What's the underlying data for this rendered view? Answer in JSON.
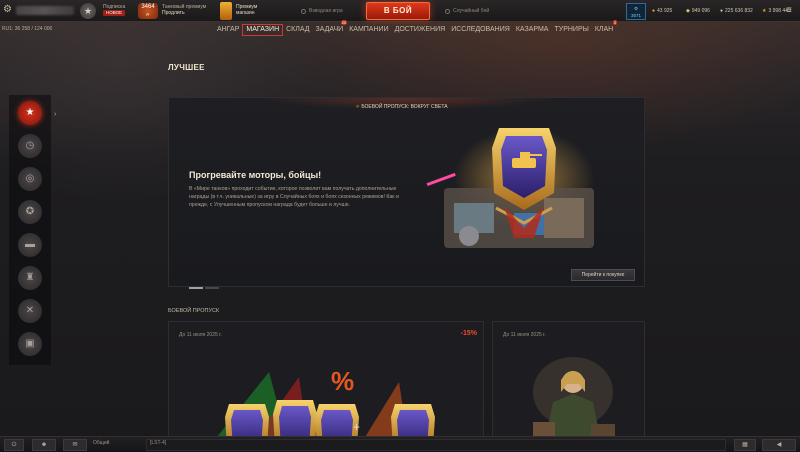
{
  "topbar": {
    "subscription_label": "Подписка",
    "subscription_badge": "НОВОЕ",
    "premium_days": "3464",
    "premium_days_unit": "д.",
    "tank_premium_label": "Танковый премиум",
    "tank_premium_action": "Продлить",
    "premium_shop_line1": "Премиум",
    "premium_shop_line2": "магазин",
    "mode_left": "Взводная игра",
    "battle_label": "В БОЙ",
    "mode_right": "Случайный бой",
    "crew_count": "3571",
    "currencies": [
      {
        "icon": "gold-icon",
        "value": "43 925"
      },
      {
        "icon": "bond-icon",
        "value": "949 096"
      },
      {
        "icon": "credits-icon",
        "value": "225 636 832"
      },
      {
        "icon": "freexp-icon",
        "value": "3 998 443"
      }
    ]
  },
  "rating": "RU1: 36 258  /  124 006",
  "nav": {
    "items": [
      {
        "label": "АНГАР",
        "active": false,
        "badge": ""
      },
      {
        "label": "МАГАЗИН",
        "active": true,
        "badge": ""
      },
      {
        "label": "СКЛАД",
        "active": false,
        "badge": ""
      },
      {
        "label": "ЗАДАЧИ",
        "active": false,
        "badge": "20"
      },
      {
        "label": "КАМПАНИИ",
        "active": false,
        "badge": ""
      },
      {
        "label": "ДОСТИЖЕНИЯ",
        "active": false,
        "badge": ""
      },
      {
        "label": "ИССЛЕДОВАНИЯ",
        "active": false,
        "badge": ""
      },
      {
        "label": "КАЗАРМА",
        "active": false,
        "badge": ""
      },
      {
        "label": "ТУРНИРЫ",
        "active": false,
        "badge": ""
      },
      {
        "label": "КЛАН",
        "active": false,
        "badge": "2"
      }
    ]
  },
  "sidebar": {
    "items": [
      {
        "icon": "star-icon",
        "active": true
      },
      {
        "icon": "clock-icon",
        "active": false
      },
      {
        "icon": "coins-icon",
        "active": false
      },
      {
        "icon": "premium-star-icon",
        "active": false
      },
      {
        "icon": "tank-icon",
        "active": false
      },
      {
        "icon": "equipment-icon",
        "active": false
      },
      {
        "icon": "tools-icon",
        "active": false
      },
      {
        "icon": "package-icon",
        "active": false
      }
    ]
  },
  "main": {
    "title": "ЛУЧШЕЕ",
    "hero": {
      "badge": "БОЕВОЙ ПРОПУСК: ВОКРУГ СВЕТА",
      "heading": "Прогревайте моторы, бойцы!",
      "text": "В «Мире танков» проходит событие, которое позволит вам получать дополнительные награды (в т.ч. уникальные) за игру в Случайных боях и боях сезонных режимов! Как и прежде, с Улучшенным пропуском награда будет больше и лучше.",
      "button": "Перейти к покупке"
    },
    "section_title": "БОЕВОЙ ПРОПУСК",
    "cards": [
      {
        "date": "До 11 июля 2025 г.",
        "discount": "-15%",
        "percent_sign": "%",
        "plus": "+"
      },
      {
        "date": "До 11 июля 2025 г."
      }
    ]
  },
  "bottombar": {
    "channel": "Общий",
    "target": "[LST-4]"
  }
}
